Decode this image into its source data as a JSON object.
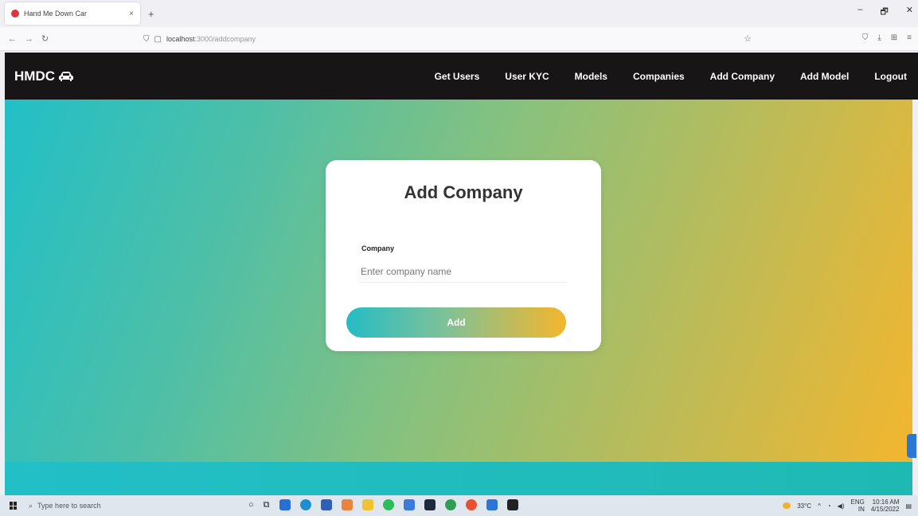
{
  "browser": {
    "tab_title": "Hand Me Down Car",
    "tab_close": "×",
    "new_tab": "+",
    "url_host": "localhost",
    "url_path": ":3000/addcompany",
    "window_controls": [
      "–",
      "🗗",
      "✕"
    ]
  },
  "app": {
    "brand": "HMDC",
    "nav": [
      "Get Users",
      "User KYC",
      "Models",
      "Companies",
      "Add Company",
      "Add Model",
      "Logout"
    ]
  },
  "form": {
    "title": "Add Company",
    "company_label": "Company",
    "company_placeholder": "Enter company name",
    "company_value": "",
    "submit_label": "Add"
  },
  "taskbar": {
    "search_placeholder": "Type here to search",
    "weather": "33°C",
    "lang": "ENG",
    "region": "IN",
    "time": "10:16 AM",
    "date": "4/15/2022"
  },
  "colors": {
    "header_bg": "#171515",
    "gradient_start": "#22bfc7",
    "gradient_end": "#f3b62e"
  }
}
